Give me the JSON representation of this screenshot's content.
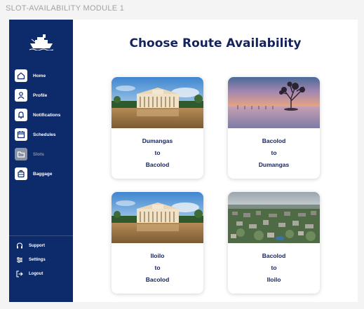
{
  "frame_title": "SLOT-AVAILABILITY MODULE 1",
  "sidebar": {
    "items": [
      {
        "label": "Home",
        "icon": "home-icon"
      },
      {
        "label": "Profile",
        "icon": "profile-icon"
      },
      {
        "label": "Notifications",
        "icon": "bell-icon"
      },
      {
        "label": "Schedules",
        "icon": "calendar-icon"
      },
      {
        "label": "Slots",
        "icon": "folder-icon"
      },
      {
        "label": "Baggage",
        "icon": "luggage-icon"
      }
    ],
    "bottom": [
      {
        "label": "Support",
        "icon": "headset-icon"
      },
      {
        "label": "Settings",
        "icon": "sliders-icon"
      },
      {
        "label": "Logout",
        "icon": "logout-icon"
      }
    ]
  },
  "main": {
    "title": "Choose Route Availability",
    "routes": [
      {
        "from": "Dumangas",
        "to_word": "to",
        "to": "Bacolod",
        "image": "government-building-photo"
      },
      {
        "from": "Bacolod",
        "to_word": "to",
        "to": "Dumangas",
        "image": "mangrove-sunset-photo"
      },
      {
        "from": "Iloilo",
        "to_word": "to",
        "to": "Bacolod",
        "image": "government-building-photo"
      },
      {
        "from": "Bacolod",
        "to_word": "to",
        "to": "Iloilo",
        "image": "city-aerial-photo"
      }
    ]
  },
  "colors": {
    "sidebar": "#0d2a6b",
    "title": "#14235c",
    "background": "#f4f4f5"
  }
}
